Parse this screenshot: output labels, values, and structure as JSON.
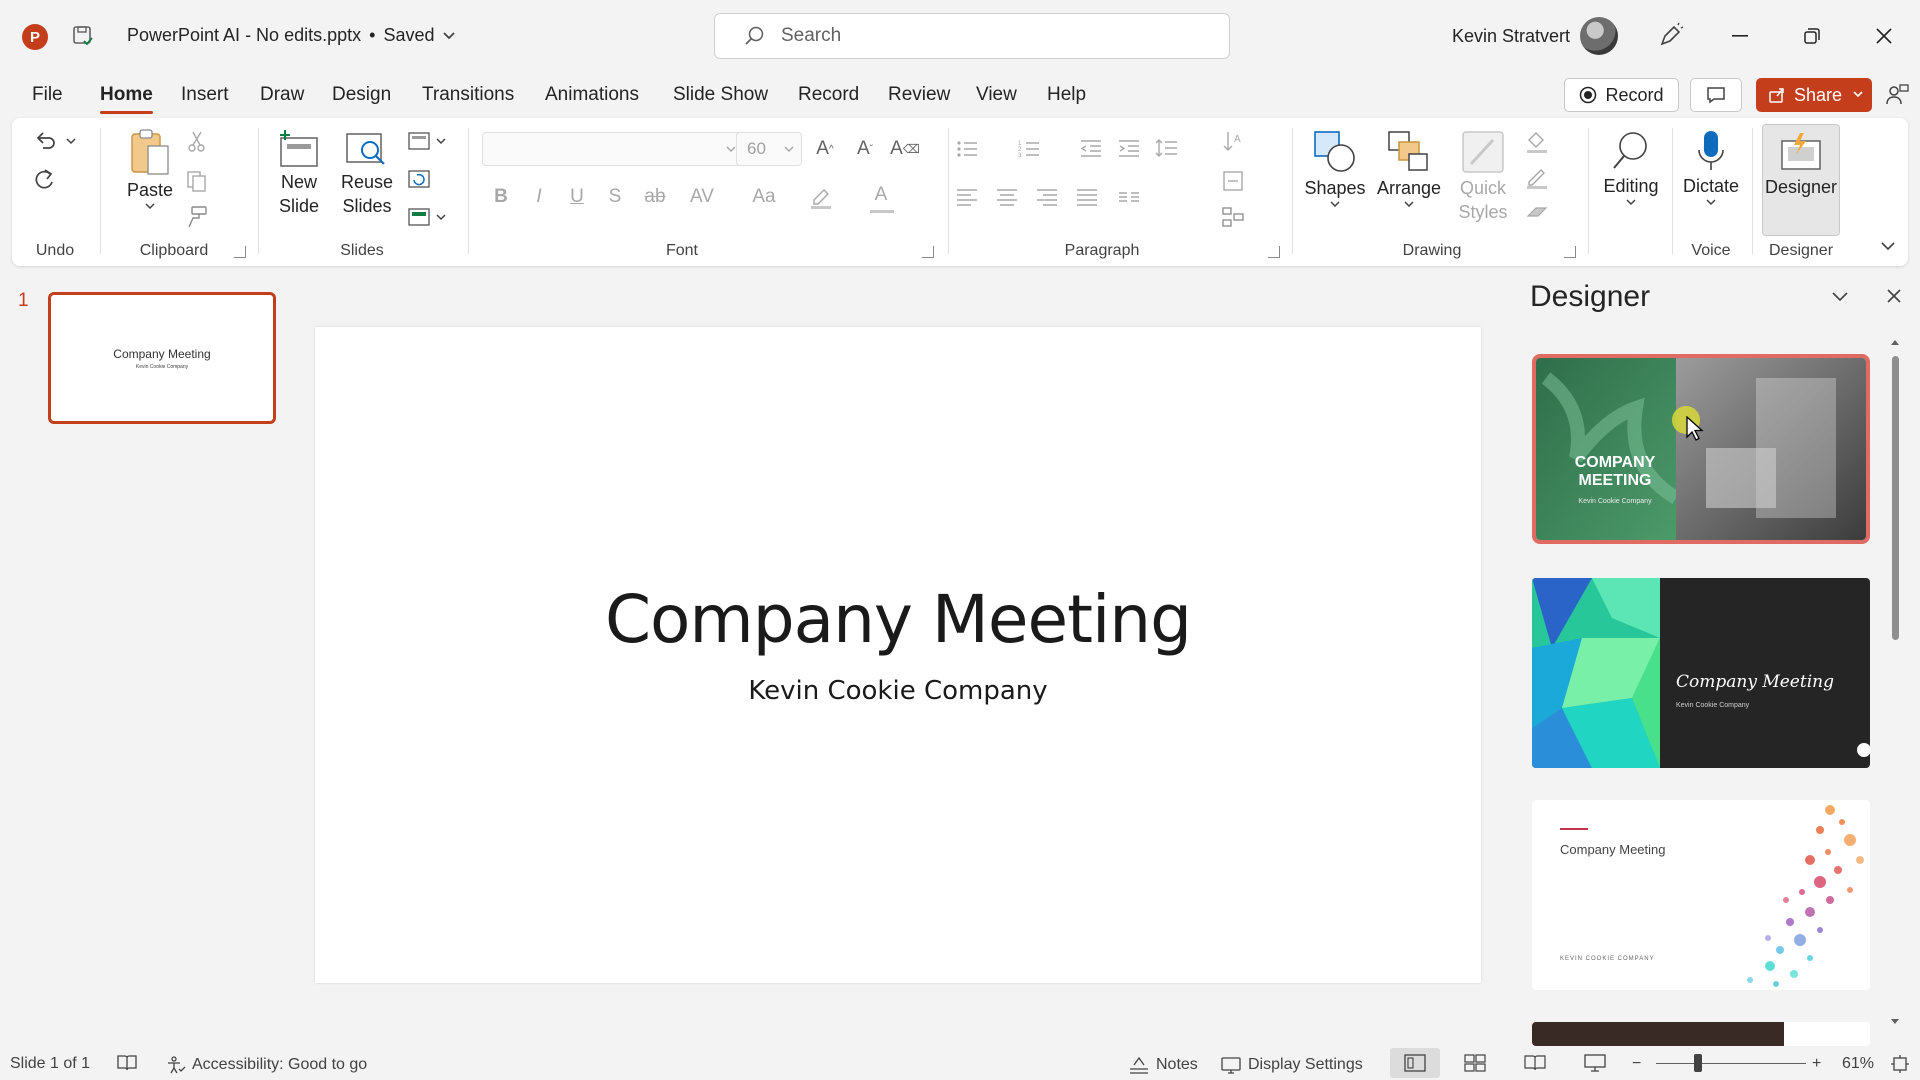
{
  "app": {
    "logo_letter": "P",
    "doc_title": "PowerPoint AI - No edits.pptx",
    "save_state": "Saved",
    "search_placeholder": "Search",
    "user_name": "Kevin Stratvert"
  },
  "menu": {
    "tabs": [
      "File",
      "Home",
      "Insert",
      "Draw",
      "Design",
      "Transitions",
      "Animations",
      "Slide Show",
      "Record",
      "Review",
      "View",
      "Help"
    ],
    "record_label": "Record",
    "share_label": "Share"
  },
  "ribbon": {
    "groups": {
      "undo": "Undo",
      "clipboard": "Clipboard",
      "slides": "Slides",
      "font": "Font",
      "paragraph": "Paragraph",
      "drawing": "Drawing",
      "voice": "Voice",
      "designer": "Designer"
    },
    "paste": "Paste",
    "new_slide_line1": "New",
    "new_slide_line2": "Slide",
    "reuse_line1": "Reuse",
    "reuse_line2": "Slides",
    "font_size": "60",
    "shapes": "Shapes",
    "arrange": "Arrange",
    "quick_line1": "Quick",
    "quick_line2": "Styles",
    "editing": "Editing",
    "dictate": "Dictate",
    "designer_btn": "Designer"
  },
  "thumbnails": {
    "slide_number": "1",
    "title": "Company Meeting",
    "subtitle": "Kevin Cookie Company"
  },
  "slide": {
    "title": "Company Meeting",
    "subtitle": "Kevin Cookie Company"
  },
  "designer": {
    "title": "Designer",
    "cards": [
      {
        "title_line1": "COMPANY",
        "title_line2": "MEETING",
        "subtitle": "Kevin Cookie Company"
      },
      {
        "title": "Company Meeting",
        "subtitle": "Kevin Cookie Company"
      },
      {
        "title": "Company Meeting",
        "subtitle": "KEVIN COOKIE COMPANY"
      }
    ]
  },
  "status": {
    "slide_info": "Slide 1 of 1",
    "accessibility": "Accessibility: Good to go",
    "notes": "Notes",
    "display_settings": "Display Settings",
    "zoom": "61%",
    "zoom_value": 0.61
  },
  "colors": {
    "accent": "#c43e1c",
    "selected_card_border": "#e06b63"
  }
}
